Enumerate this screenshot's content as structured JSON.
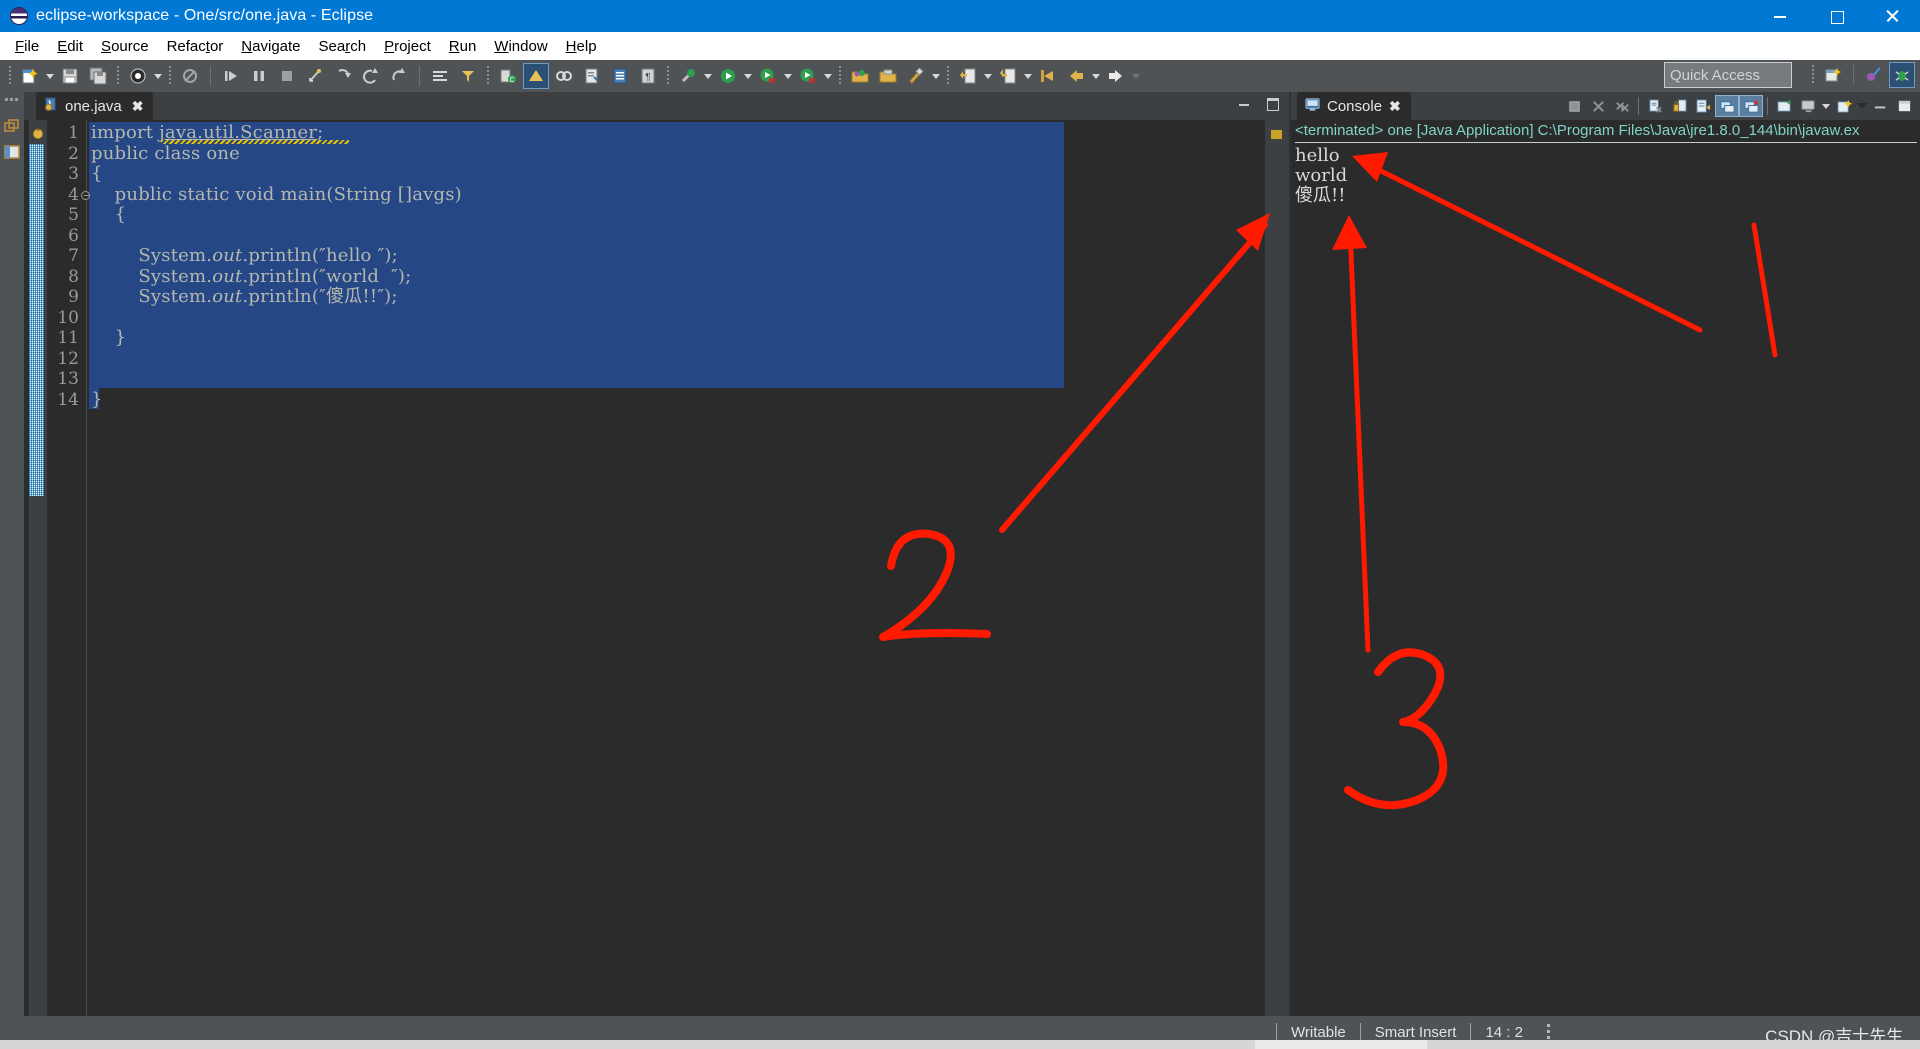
{
  "window": {
    "title": "eclipse-workspace - One/src/one.java - Eclipse",
    "logo_icon": "eclipse-logo-icon",
    "minimize_label": "Minimize",
    "maximize_label": "Maximize",
    "close_label": "Close",
    "accent_color": "#0078d4"
  },
  "menubar": {
    "items": [
      {
        "label": "File",
        "mnemonic": "F"
      },
      {
        "label": "Edit",
        "mnemonic": "E"
      },
      {
        "label": "Source",
        "mnemonic": "S"
      },
      {
        "label": "Refactor",
        "mnemonic": "t"
      },
      {
        "label": "Navigate",
        "mnemonic": "N"
      },
      {
        "label": "Search",
        "mnemonic": "r"
      },
      {
        "label": "Project",
        "mnemonic": "P"
      },
      {
        "label": "Run",
        "mnemonic": "R"
      },
      {
        "label": "Window",
        "mnemonic": "W"
      },
      {
        "label": "Help",
        "mnemonic": "H"
      }
    ]
  },
  "toolbar": {
    "groups": [
      {
        "items": [
          {
            "name": "new-wizard-icon",
            "caret": true
          },
          {
            "name": "save-icon"
          },
          {
            "name": "save-all-icon"
          }
        ]
      },
      {
        "items": [
          {
            "name": "debug-profile-icon",
            "caret": true
          }
        ]
      },
      {
        "items": [
          {
            "name": "skip-breakpoints-icon"
          }
        ]
      },
      {
        "items": [
          {
            "name": "resume-icon"
          },
          {
            "name": "suspend-icon"
          },
          {
            "name": "terminate-icon"
          },
          {
            "name": "disconnect-icon"
          },
          {
            "name": "step-into-icon"
          },
          {
            "name": "step-over-icon"
          },
          {
            "name": "step-return-icon"
          }
        ]
      },
      {
        "items": [
          {
            "name": "toggle-breakpoint-icon"
          },
          {
            "name": "step-filters-icon"
          }
        ]
      },
      {
        "items": [
          {
            "name": "new-java-class-icon"
          },
          {
            "name": "new-java-package-icon"
          },
          {
            "name": "link-icon"
          },
          {
            "name": "open-type-icon"
          },
          {
            "name": "open-task-icon"
          },
          {
            "name": "paragraph-icon"
          }
        ]
      },
      {
        "items": [
          {
            "name": "external-tools-icon",
            "caret": true
          },
          {
            "name": "run-icon",
            "caret": true
          },
          {
            "name": "debug-icon",
            "caret": true
          },
          {
            "name": "coverage-icon",
            "caret": true
          }
        ]
      },
      {
        "items": [
          {
            "name": "new-project-icon"
          },
          {
            "name": "open-perspective-icon"
          },
          {
            "name": "search-icon",
            "caret": true
          }
        ]
      },
      {
        "items": [
          {
            "name": "previous-annotation-icon",
            "caret": true
          },
          {
            "name": "next-annotation-icon",
            "caret": true
          },
          {
            "name": "last-edit-location-icon",
            "caret": true
          },
          {
            "name": "back-icon"
          },
          {
            "name": "forward-icon",
            "caret": true
          }
        ]
      }
    ],
    "quick_access": {
      "placeholder": "Quick Access",
      "name": "quick-access-input"
    },
    "perspectives": [
      {
        "name": "open-perspective-button-icon"
      },
      {
        "name": "java-perspective-icon"
      },
      {
        "name": "debug-perspective-icon",
        "selected": true
      }
    ]
  },
  "rail": {
    "items": [
      {
        "name": "restore-icon"
      },
      {
        "name": "package-explorer-icon"
      }
    ]
  },
  "editor": {
    "tab": {
      "label": "one.java",
      "icon": "java-file-icon",
      "close": "✖",
      "active": true
    },
    "minimize_label": "Minimize",
    "maximize_label": "Maximize",
    "annotation_icon": "warning-marker-icon",
    "marker_color": "#c9a227",
    "selection_color": "#254785",
    "background_color": "#2b2b2b",
    "text_color": "#b6b8ae",
    "lines": [
      {
        "num": 1,
        "text": "import java.util.Scanner;",
        "underline_from": 7,
        "underline_to": 24,
        "squiggle": true,
        "selected": true,
        "fold": false
      },
      {
        "num": 2,
        "text": "public class one",
        "selected": true,
        "fold": false
      },
      {
        "num": 3,
        "text": "{",
        "selected": true,
        "fold": false
      },
      {
        "num": 4,
        "text": "    public static void main(String []avgs)",
        "selected": true,
        "fold": true
      },
      {
        "num": 5,
        "text": "    {",
        "selected": true,
        "fold": false
      },
      {
        "num": 6,
        "text": "",
        "selected": true,
        "fold": false
      },
      {
        "num": 7,
        "text": "        System.out.println(″hello ″);",
        "selected": true,
        "fold": false
      },
      {
        "num": 8,
        "text": "        System.out.println(″world  ″);",
        "selected": true,
        "fold": false
      },
      {
        "num": 9,
        "text": "        System.out.println(″傻瓜!!″);",
        "selected": true,
        "fold": false
      },
      {
        "num": 10,
        "text": "",
        "selected": true,
        "fold": false
      },
      {
        "num": 11,
        "text": "    }",
        "selected": true,
        "fold": false
      },
      {
        "num": 12,
        "text": "",
        "selected": true,
        "fold": false
      },
      {
        "num": 13,
        "text": "",
        "selected": true,
        "fold": false
      },
      {
        "num": 14,
        "text": "}",
        "selected": false,
        "fold": false
      }
    ]
  },
  "console": {
    "tab": {
      "label": "Console",
      "icon": "console-icon",
      "close": "✖"
    },
    "toolbar": [
      {
        "name": "terminate-icon"
      },
      {
        "name": "remove-launch-icon"
      },
      {
        "name": "remove-all-terminated-icon"
      },
      {
        "name": "clear-console-icon"
      },
      {
        "name": "scroll-lock-icon"
      },
      {
        "name": "word-wrap-icon"
      },
      {
        "name": "show-console-on-output-icon",
        "selected": true
      },
      {
        "name": "show-console-on-error-icon",
        "selected": true
      },
      {
        "name": "pin-console-icon"
      },
      {
        "name": "display-selected-console-icon",
        "caret": true
      },
      {
        "name": "open-console-icon",
        "caret": true
      },
      {
        "name": "minimize-icon"
      },
      {
        "name": "maximize-icon"
      }
    ],
    "header": "<terminated> one [Java Application] C:\\Program Files\\Java\\jre1.8.0_144\\bin\\javaw.ex",
    "header_color": "#7fd3c8",
    "output_lines": [
      "hello",
      "world",
      "傻瓜!!"
    ]
  },
  "annotations": {
    "marker_color": "#ff1a00",
    "marks": [
      {
        "label": "2",
        "name": "handwritten-2-annotation"
      },
      {
        "label": "3",
        "name": "handwritten-3-annotation"
      },
      {
        "label": "arrow-to-editor",
        "name": "arrow-annotation-editor"
      },
      {
        "label": "arrow-to-console-output",
        "name": "arrow-annotation-console"
      },
      {
        "label": "arrow-to-hello",
        "name": "arrow-annotation-hello"
      },
      {
        "label": "stroke-1",
        "name": "handwritten-1-annotation"
      }
    ]
  },
  "statusbar": {
    "writable": "Writable",
    "insert_mode": "Smart Insert",
    "cursor_position": "14 : 2",
    "watermark": "CSDN @吉士先生."
  }
}
